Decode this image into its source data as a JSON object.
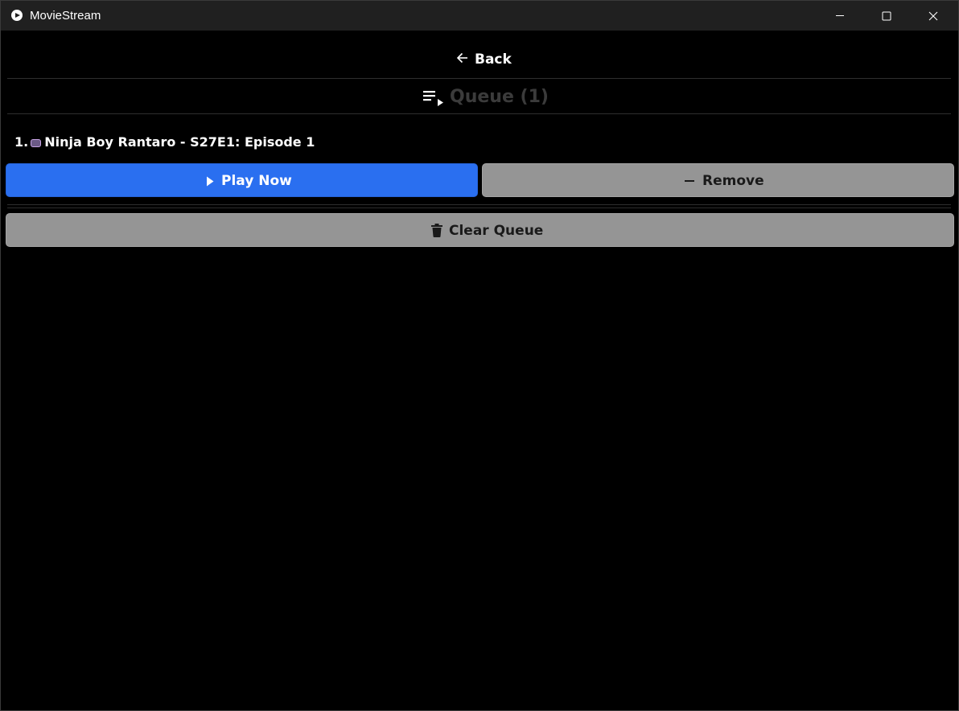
{
  "window": {
    "title": "MovieStream",
    "controls": [
      "minimize-icon",
      "maximize-icon",
      "close-icon"
    ]
  },
  "nav": {
    "back_label": "Back",
    "back_icon": "arrow-left-icon"
  },
  "queue": {
    "header_icon": "queue-music-icon",
    "title": "Queue (1)",
    "items": [
      {
        "index": "1.",
        "icon": "tv-icon",
        "title": "Ninja Boy Rantaro - S27E1: Episode 1"
      }
    ],
    "play_label": "Play Now",
    "remove_label": "Remove",
    "clear_label": "Clear Queue"
  },
  "colors": {
    "play_button": "#2a6ff0",
    "secondary_button": "#959595",
    "background": "#000000",
    "titlebar": "#202020",
    "queue_title": "#3b3b3b"
  }
}
